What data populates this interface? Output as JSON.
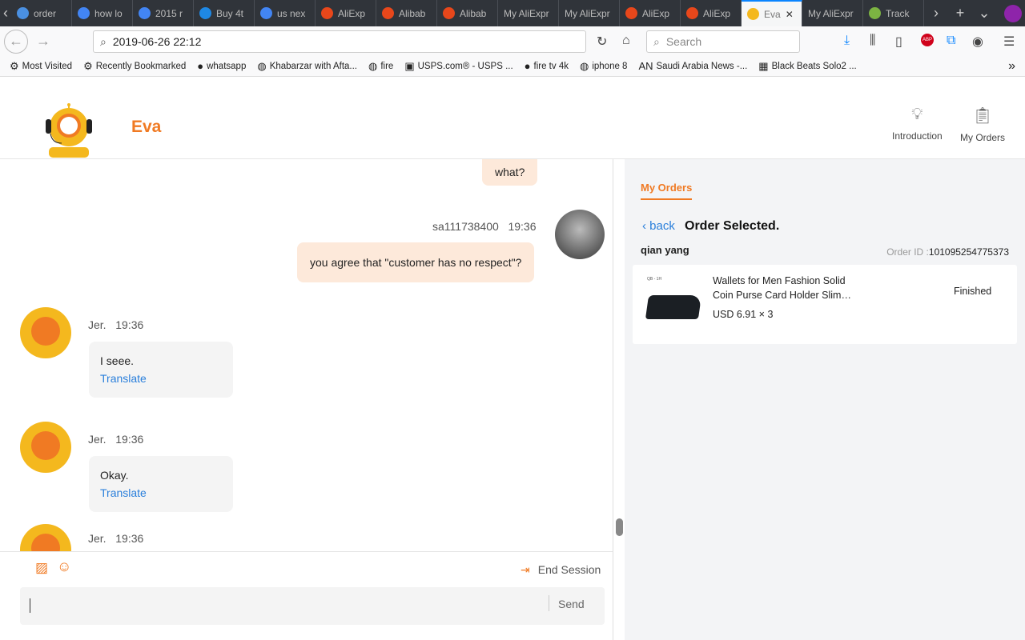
{
  "browser": {
    "tabs": [
      {
        "label": "order",
        "fav": "#4a90e2"
      },
      {
        "label": "how lo",
        "fav": "#4285f4"
      },
      {
        "label": "2015 r",
        "fav": "#4285f4"
      },
      {
        "label": "Buy 4t",
        "fav": "#1e88e5"
      },
      {
        "label": "us nex",
        "fav": "#4285f4"
      },
      {
        "label": "AliExp",
        "fav": "#e8471b"
      },
      {
        "label": "Alibab",
        "fav": "#e8471b"
      },
      {
        "label": "Alibab",
        "fav": "#e8471b"
      },
      {
        "label": "My AliExpr",
        "fav": ""
      },
      {
        "label": "My AliExpr",
        "fav": ""
      },
      {
        "label": "AliExp",
        "fav": "#e8471b"
      },
      {
        "label": "AliExp",
        "fav": "#e8471b"
      },
      {
        "label": "Eva",
        "fav": "#f4b81e",
        "active": true
      },
      {
        "label": "My AliExpr",
        "fav": ""
      },
      {
        "label": "Track",
        "fav": "#7cb342"
      }
    ],
    "url": "2019-06-26 22:12",
    "search_placeholder": "Search",
    "bookmarks": [
      {
        "icon": "⚙",
        "label": "Most Visited"
      },
      {
        "icon": "⚙",
        "label": "Recently Bookmarked"
      },
      {
        "icon": "●",
        "label": "whatsapp"
      },
      {
        "icon": "◍",
        "label": "Khabarzar with Afta..."
      },
      {
        "icon": "◍",
        "label": "fire"
      },
      {
        "icon": "▣",
        "label": "USPS.com® - USPS ..."
      },
      {
        "icon": "●",
        "label": "fire tv 4k"
      },
      {
        "icon": "◍",
        "label": "iphone 8"
      },
      {
        "icon": "AN",
        "label": "Saudi Arabia News -..."
      },
      {
        "icon": "▦",
        "label": "Black Beats Solo2 ..."
      }
    ]
  },
  "header": {
    "bot_name": "Eva",
    "nav": [
      {
        "icon": "lightbulb",
        "label": "Introduction"
      },
      {
        "icon": "clipboard",
        "label": "My Orders"
      }
    ]
  },
  "chat": {
    "messages": [
      {
        "from": "me",
        "text": "what?"
      },
      {
        "from": "me",
        "user": "sa111738400",
        "time": "19:36",
        "text": "you agree that \"customer has no respect\"?"
      },
      {
        "from": "agent",
        "user": "Jer.",
        "time": "19:36",
        "text": "I seee.",
        "translate": "Translate"
      },
      {
        "from": "agent",
        "user": "Jer.",
        "time": "19:36",
        "text": "Okay.",
        "translate": "Translate"
      },
      {
        "from": "agent",
        "user": "Jer.",
        "time": "19:36"
      }
    ],
    "end_session": "End Session",
    "send": "Send"
  },
  "orders": {
    "tab": "My Orders",
    "back": "back",
    "title": "Order Selected.",
    "buyer": "qian yang",
    "order_id_label": "Order ID :",
    "order_id": "101095254775373",
    "item": {
      "name_line1": "Wallets for Men Fashion Solid",
      "name_line2": "Coin Purse Card Holder Slim…",
      "price": "USD 6.91 × 3",
      "status": "Finished",
      "img_label": "QB - 1H"
    }
  },
  "colors": {
    "accent": "#f07a23",
    "link": "#2a7fdb",
    "bubble": "#fde9da"
  }
}
